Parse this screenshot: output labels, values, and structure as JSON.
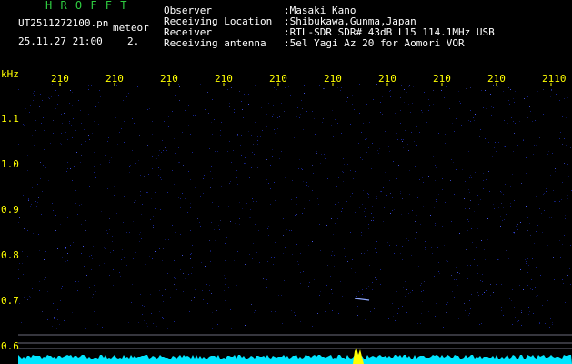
{
  "header": {
    "brand": "H R O F F T",
    "file_name": "UT2511272100.pn",
    "mode": "meteor",
    "date_time": "25.11.27 21:00",
    "count": "2.",
    "labels": {
      "observer": "Observer",
      "location": "Receiving Location",
      "receiver": "Receiver",
      "antenna": "Receiving antenna"
    },
    "values": {
      "observer": ":Masaki Kano",
      "location": ":Shibukawa,Gunma,Japan",
      "receiver": ":RTL-SDR SDR# 43dB L15 114.1MHz USB",
      "antenna": ":5el Yagi Az 20 for Aomori VOR"
    }
  },
  "axes": {
    "unit": "kHz",
    "x_ticks": [
      "210",
      "210",
      "210",
      "210",
      "210",
      "210",
      "210",
      "210",
      "210",
      "2110"
    ],
    "y_ticks": [
      "1.1",
      "1.0",
      "0.9",
      "0.8",
      "0.7",
      "0.6"
    ]
  },
  "colors": {
    "background": "#000000",
    "noise": "#1a2aa8",
    "signal": "#ffff00",
    "baseline": "#00e5ff",
    "label": "#ffff00",
    "brand": "#2ecc40"
  }
}
